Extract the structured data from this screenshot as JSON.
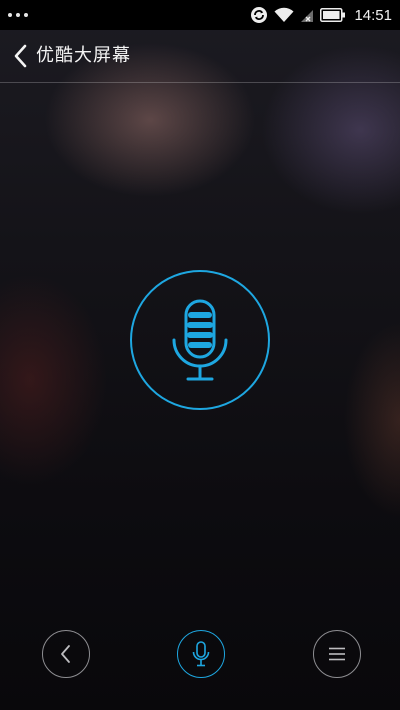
{
  "status_bar": {
    "time": "14:51",
    "icons": [
      "overflow-dots-icon",
      "sync-icon",
      "wifi-icon",
      "no-signal-icon",
      "battery-icon"
    ]
  },
  "header": {
    "back_icon": "chevron-left-icon",
    "title": "优酷大屏幕"
  },
  "center": {
    "icon": "microphone-icon"
  },
  "bottom_bar": {
    "buttons": [
      {
        "icon": "chevron-left-icon"
      },
      {
        "icon": "microphone-icon"
      },
      {
        "icon": "menu-icon"
      }
    ]
  },
  "colors": {
    "accent": "#1ea7e1",
    "inactive": "#8e8e92",
    "text": "#f4f4f4"
  }
}
